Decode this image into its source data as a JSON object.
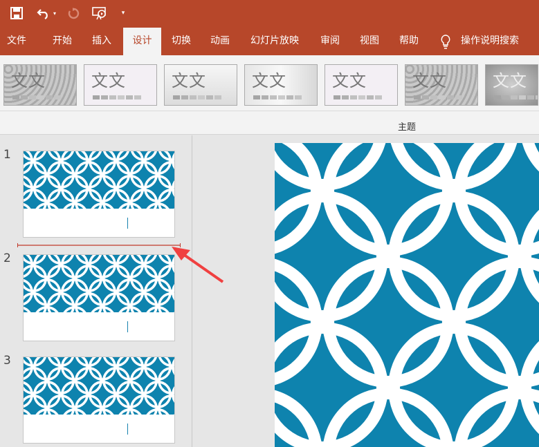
{
  "quick_access": {
    "icons": [
      "save-icon",
      "undo-icon",
      "undo-dropdown-icon",
      "redo-icon",
      "present-from-start-icon",
      "customize-toolbar-icon"
    ]
  },
  "tabs": [
    {
      "label": "文件"
    },
    {
      "label": "开始"
    },
    {
      "label": "插入"
    },
    {
      "label": "设计",
      "active": true
    },
    {
      "label": "切换"
    },
    {
      "label": "动画"
    },
    {
      "label": "幻灯片放映"
    },
    {
      "label": "审阅"
    },
    {
      "label": "视图"
    },
    {
      "label": "帮助"
    }
  ],
  "search": {
    "label": "操作说明搜索",
    "icon": "lightbulb-icon"
  },
  "themes": {
    "preview_text": "文文",
    "group_label": "主题",
    "count": 7
  },
  "slides": [
    {
      "number": "1"
    },
    {
      "number": "2"
    },
    {
      "number": "3"
    }
  ],
  "colors": {
    "brand": "#b7472a",
    "slide_blue": "#0e83ae",
    "annotation_red": "#f04040",
    "drop_line": "#c0392b"
  }
}
